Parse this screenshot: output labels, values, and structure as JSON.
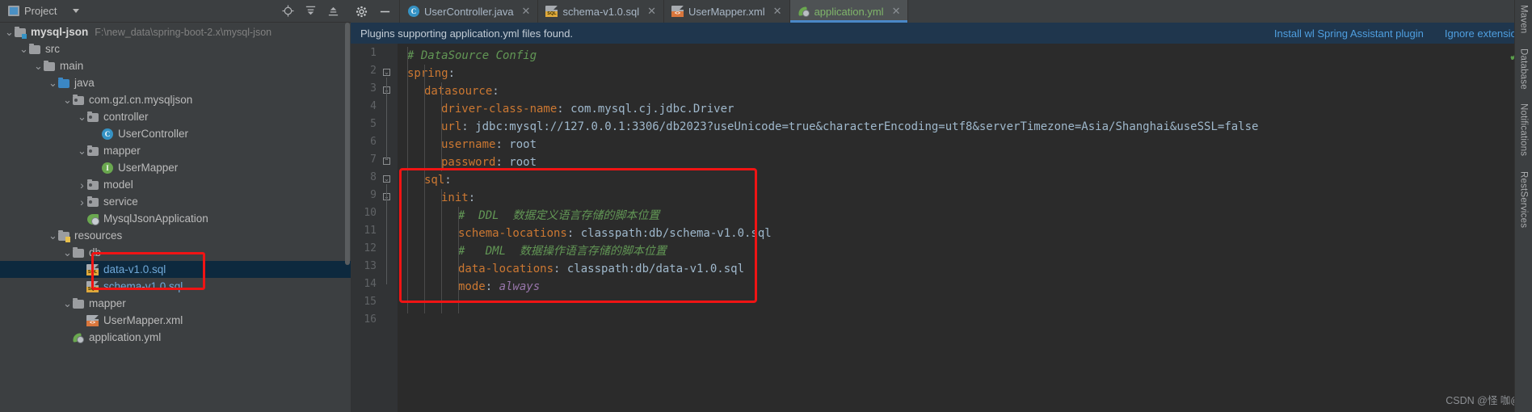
{
  "project_panel": {
    "header": {
      "title": "Project",
      "caret_icon": "chevron-down-icon"
    },
    "header_icons": [
      "locate-icon",
      "collapse-all-icon",
      "expand-all-icon"
    ],
    "tree": [
      {
        "label": "mysql-json",
        "path": "F:\\new_data\\spring-boot-2.x\\mysql-json",
        "icon": "module-folder-icon",
        "arrow": "expanded",
        "indent": 0,
        "bold": true
      },
      {
        "label": "src",
        "icon": "folder-icon",
        "arrow": "expanded",
        "indent": 1
      },
      {
        "label": "main",
        "icon": "folder-icon",
        "arrow": "expanded",
        "indent": 2
      },
      {
        "label": "java",
        "icon": "source-folder-icon",
        "arrow": "expanded",
        "indent": 3
      },
      {
        "label": "com.gzl.cn.mysqljson",
        "icon": "package-icon",
        "arrow": "expanded",
        "indent": 4
      },
      {
        "label": "controller",
        "icon": "package-icon",
        "arrow": "expanded",
        "indent": 5
      },
      {
        "label": "UserController",
        "icon": "java-class-icon",
        "arrow": "none",
        "indent": 6
      },
      {
        "label": "mapper",
        "icon": "package-icon",
        "arrow": "expanded",
        "indent": 5
      },
      {
        "label": "UserMapper",
        "icon": "java-interface-icon",
        "arrow": "none",
        "indent": 6
      },
      {
        "label": "model",
        "icon": "package-icon",
        "arrow": "collapsed",
        "indent": 5
      },
      {
        "label": "service",
        "icon": "package-icon",
        "arrow": "collapsed",
        "indent": 5
      },
      {
        "label": "MysqlJsonApplication",
        "icon": "spring-boot-icon",
        "arrow": "none",
        "indent": 5
      },
      {
        "label": "resources",
        "icon": "resources-folder-icon",
        "arrow": "expanded",
        "indent": 3
      },
      {
        "label": "db",
        "icon": "folder-icon",
        "arrow": "expanded",
        "indent": 4
      },
      {
        "label": "data-v1.0.sql",
        "icon": "sql-file-icon",
        "arrow": "none",
        "indent": 5,
        "selected": true,
        "blue": true
      },
      {
        "label": "schema-v1.0.sql",
        "icon": "sql-file-icon",
        "arrow": "none",
        "indent": 5,
        "blue": true
      },
      {
        "label": "mapper",
        "icon": "folder-icon",
        "arrow": "expanded",
        "indent": 4
      },
      {
        "label": "UserMapper.xml",
        "icon": "xml-file-icon",
        "arrow": "none",
        "indent": 5
      },
      {
        "label": "application.yml",
        "icon": "spring-yaml-icon",
        "arrow": "none",
        "indent": 4
      }
    ]
  },
  "tabbar": {
    "left_icons": [
      "settings-gear-icon",
      "hide-icon"
    ],
    "tabs": [
      {
        "label": "UserController.java",
        "icon": "java-class-icon",
        "active": false,
        "close_icon": "close-icon"
      },
      {
        "label": "schema-v1.0.sql",
        "icon": "sql-file-icon",
        "active": false,
        "close_icon": "close-icon"
      },
      {
        "label": "UserMapper.xml",
        "icon": "xml-file-icon",
        "active": false,
        "close_icon": "close-icon"
      },
      {
        "label": "application.yml",
        "icon": "spring-yaml-icon",
        "active": true,
        "close_icon": "close-icon"
      }
    ],
    "right_icons": [
      "more-options-icon"
    ]
  },
  "notification": {
    "message": "Plugins supporting application.yml files found.",
    "install_link": "Install wl Spring Assistant plugin",
    "ignore_link": "Ignore extension"
  },
  "editor": {
    "filename": "application.yml",
    "line_numbers": [
      1,
      2,
      3,
      4,
      5,
      6,
      7,
      8,
      9,
      10,
      11,
      12,
      13,
      14,
      15,
      16
    ],
    "lines": [
      {
        "n": 1,
        "indent": 0,
        "tokens": [
          {
            "t": "# DataSource Config",
            "c": "cm"
          }
        ]
      },
      {
        "n": 2,
        "indent": 0,
        "tokens": [
          {
            "t": "spring",
            "c": "k"
          },
          {
            "t": ":",
            "c": "p"
          }
        ]
      },
      {
        "n": 3,
        "indent": 1,
        "tokens": [
          {
            "t": "datasource",
            "c": "k"
          },
          {
            "t": ":",
            "c": "p"
          }
        ]
      },
      {
        "n": 4,
        "indent": 2,
        "tokens": [
          {
            "t": "driver-class-name",
            "c": "k"
          },
          {
            "t": ": ",
            "c": "p"
          },
          {
            "t": "com.mysql.cj.jdbc.Driver",
            "c": "v"
          }
        ]
      },
      {
        "n": 5,
        "indent": 2,
        "tokens": [
          {
            "t": "url",
            "c": "k"
          },
          {
            "t": ": ",
            "c": "p"
          },
          {
            "t": "jdbc:mysql://127.0.0.1:3306/db2023?useUnicode=true&characterEncoding=utf8&serverTimezone=Asia/Shanghai&useSSL=false",
            "c": "v"
          }
        ]
      },
      {
        "n": 6,
        "indent": 2,
        "tokens": [
          {
            "t": "username",
            "c": "k"
          },
          {
            "t": ": ",
            "c": "p"
          },
          {
            "t": "root",
            "c": "v"
          }
        ]
      },
      {
        "n": 7,
        "indent": 2,
        "tokens": [
          {
            "t": "password",
            "c": "k"
          },
          {
            "t": ": ",
            "c": "p"
          },
          {
            "t": "root",
            "c": "v"
          }
        ]
      },
      {
        "n": 8,
        "indent": 1,
        "tokens": [
          {
            "t": "sql",
            "c": "k"
          },
          {
            "t": ":",
            "c": "p"
          }
        ]
      },
      {
        "n": 9,
        "indent": 2,
        "tokens": [
          {
            "t": "init",
            "c": "k"
          },
          {
            "t": ":",
            "c": "p"
          }
        ]
      },
      {
        "n": 10,
        "indent": 3,
        "tokens": [
          {
            "t": "#  DDL  数据定义语言存储的脚本位置",
            "c": "cm"
          }
        ]
      },
      {
        "n": 11,
        "indent": 3,
        "tokens": [
          {
            "t": "schema-locations",
            "c": "k"
          },
          {
            "t": ": ",
            "c": "p"
          },
          {
            "t": "classpath:db/schema-v1.0.sql",
            "c": "v"
          }
        ]
      },
      {
        "n": 12,
        "indent": 3,
        "tokens": [
          {
            "t": "#   DML  数据操作语言存储的脚本位置",
            "c": "cm"
          }
        ]
      },
      {
        "n": 13,
        "indent": 3,
        "tokens": [
          {
            "t": "data-locations",
            "c": "k"
          },
          {
            "t": ": ",
            "c": "p"
          },
          {
            "t": "classpath:db/data-v1.0.sql",
            "c": "v"
          }
        ]
      },
      {
        "n": 14,
        "indent": 3,
        "tokens": [
          {
            "t": "mode",
            "c": "k"
          },
          {
            "t": ": ",
            "c": "p"
          },
          {
            "t": "always",
            "c": "vi"
          }
        ]
      },
      {
        "n": 15,
        "indent": 0,
        "tokens": []
      },
      {
        "n": 16,
        "indent": 0,
        "tokens": []
      }
    ],
    "inspection_status_icon": "checkmark-ok-icon",
    "watermark": "CSDN @怪 咖@"
  },
  "toolstrip": {
    "items": [
      "Maven",
      "Database",
      "Notifications",
      "RestServices"
    ]
  },
  "colors": {
    "highlight_box": "#f01414",
    "accent": "#4a88c7",
    "keyword": "#cc7832",
    "value": "#9fb8cc",
    "comment": "#629755",
    "selection": "#0d293e"
  }
}
